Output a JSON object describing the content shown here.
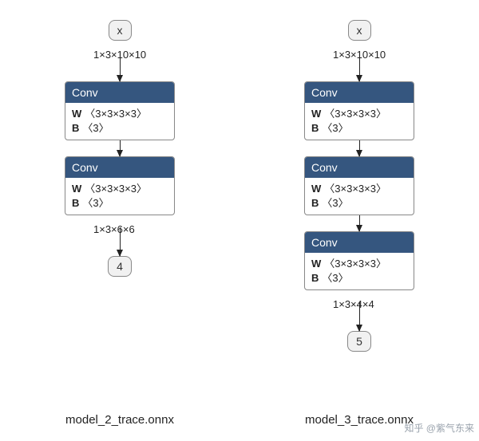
{
  "diagrams": [
    {
      "input_label": "x",
      "input_edge": "1×3×10×10",
      "ops": [
        {
          "type": "Conv",
          "W": "〈3×3×3×3〉",
          "B": "〈3〉"
        },
        {
          "type": "Conv",
          "W": "〈3×3×3×3〉",
          "B": "〈3〉"
        }
      ],
      "output_edge": "1×3×6×6",
      "output_label": "4",
      "caption": "model_2_trace.onnx"
    },
    {
      "input_label": "x",
      "input_edge": "1×3×10×10",
      "ops": [
        {
          "type": "Conv",
          "W": "〈3×3×3×3〉",
          "B": "〈3〉"
        },
        {
          "type": "Conv",
          "W": "〈3×3×3×3〉",
          "B": "〈3〉"
        },
        {
          "type": "Conv",
          "W": "〈3×3×3×3〉",
          "B": "〈3〉"
        }
      ],
      "output_edge": "1×3×4×4",
      "output_label": "5",
      "caption": "model_3_trace.onnx"
    }
  ],
  "watermark": "知乎 @紫气东来"
}
